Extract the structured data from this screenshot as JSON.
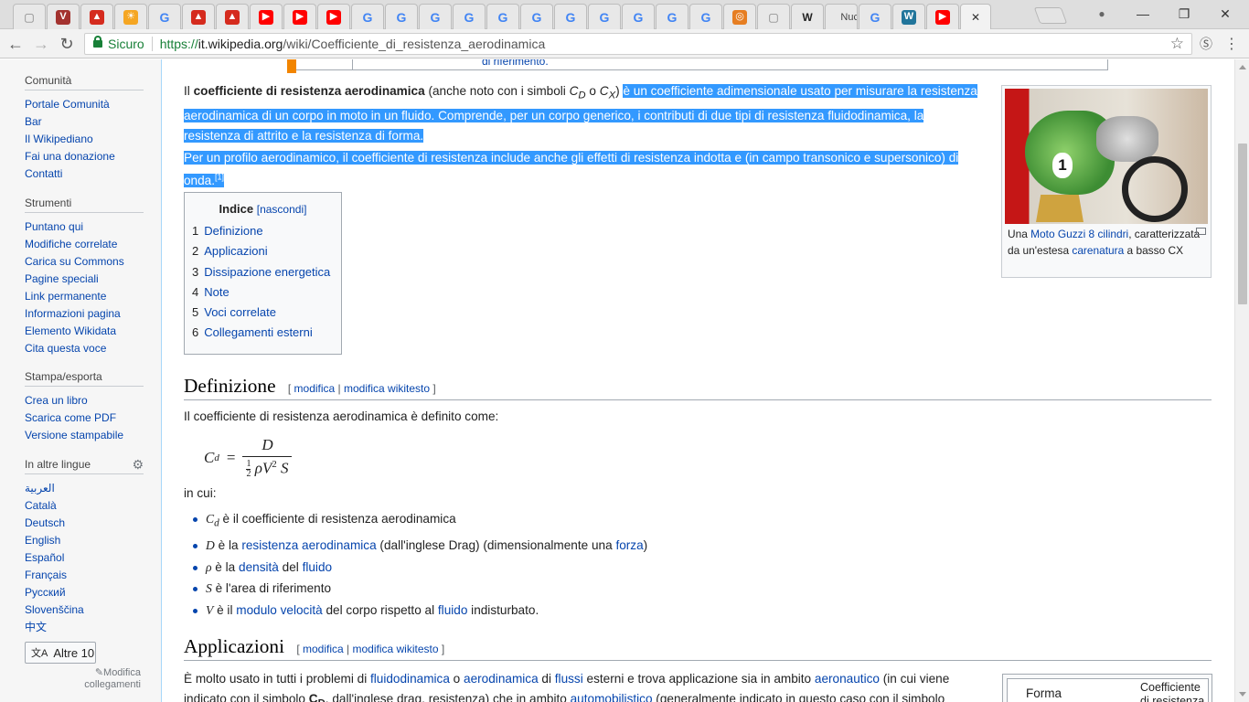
{
  "browser": {
    "tabs": [
      {
        "icon": "page-icon",
        "color": "#777777",
        "glyph": "▢"
      },
      {
        "icon": "wiki-v-icon",
        "color": "#a3322f",
        "glyph": "V"
      },
      {
        "icon": "flag-icon",
        "color": "#d52b1e",
        "glyph": "▲"
      },
      {
        "icon": "sun-icon",
        "color": "#f5a623",
        "glyph": "☀"
      },
      {
        "icon": "google-icon",
        "color": "#4285f4",
        "glyph": "G"
      },
      {
        "icon": "flag-icon",
        "color": "#d52b1e",
        "glyph": "▲"
      },
      {
        "icon": "flag-icon",
        "color": "#d52b1e",
        "glyph": "▲"
      },
      {
        "icon": "youtube-icon",
        "color": "#ff0000",
        "glyph": "▶"
      },
      {
        "icon": "youtube-icon",
        "color": "#ff0000",
        "glyph": "▶"
      },
      {
        "icon": "youtube-icon",
        "color": "#ff0000",
        "glyph": "▶"
      },
      {
        "icon": "google-icon",
        "color": "#4285f4",
        "glyph": "G"
      },
      {
        "icon": "google-icon",
        "color": "#4285f4",
        "glyph": "G"
      },
      {
        "icon": "google-icon",
        "color": "#4285f4",
        "glyph": "G"
      },
      {
        "icon": "google-icon",
        "color": "#4285f4",
        "glyph": "G"
      },
      {
        "icon": "google-icon",
        "color": "#4285f4",
        "glyph": "G"
      },
      {
        "icon": "google-icon",
        "color": "#4285f4",
        "glyph": "G"
      },
      {
        "icon": "google-icon",
        "color": "#4285f4",
        "glyph": "G"
      },
      {
        "icon": "google-icon",
        "color": "#4285f4",
        "glyph": "G"
      },
      {
        "icon": "google-icon",
        "color": "#4285f4",
        "glyph": "G"
      },
      {
        "icon": "google-icon",
        "color": "#4285f4",
        "glyph": "G"
      },
      {
        "icon": "google-icon",
        "color": "#4285f4",
        "glyph": "G"
      },
      {
        "icon": "target-icon",
        "color": "#e67e22",
        "glyph": "◎"
      },
      {
        "icon": "page-icon",
        "color": "#777777",
        "glyph": "▢"
      },
      {
        "icon": "wikipedia-icon",
        "color": "#222222",
        "glyph": "W"
      },
      {
        "icon": "text-icon",
        "color": "#555555",
        "glyph": "",
        "label": "Nuc"
      },
      {
        "icon": "google-icon",
        "color": "#4285f4",
        "glyph": "G"
      },
      {
        "icon": "wordpress-icon",
        "color": "#21759b",
        "glyph": "W"
      },
      {
        "icon": "youtube-icon",
        "color": "#ff0000",
        "glyph": "▶"
      },
      {
        "icon": "close-icon",
        "color": "#333333",
        "glyph": "✕",
        "active": true
      }
    ],
    "window_controls": [
      "person-icon",
      "minimize-icon",
      "restore-icon",
      "close-icon"
    ],
    "address": {
      "secure_label": "Sicuro",
      "scheme": "https://",
      "host": "it.wikipedia.org",
      "path": "/wiki/Coefficiente_di_resistenza_aerodinamica"
    }
  },
  "sidebar": {
    "comunita": {
      "heading": "Comunità",
      "items": [
        "Portale Comunità",
        "Bar",
        "Il Wikipediano",
        "Fai una donazione",
        "Contatti"
      ]
    },
    "strumenti": {
      "heading": "Strumenti",
      "items": [
        "Puntano qui",
        "Modifiche correlate",
        "Carica su Commons",
        "Pagine speciali",
        "Link permanente",
        "Informazioni pagina",
        "Elemento Wikidata",
        "Cita questa voce"
      ]
    },
    "stampa": {
      "heading": "Stampa/esporta",
      "items": [
        "Crea un libro",
        "Scarica come PDF",
        "Versione stampabile"
      ]
    },
    "lingue": {
      "heading": "In altre lingue",
      "items": [
        "العربية",
        "Català",
        "Deutsch",
        "English",
        "Español",
        "Français",
        "Русский",
        "Slovenščina",
        "中文"
      ]
    },
    "other_button": "Altre 10",
    "edit_links": "Modifica collegamenti"
  },
  "content": {
    "topbox_text": "di riferimento.",
    "p1": {
      "lead": "Il ",
      "term": "coefficiente di resistenza aerodinamica",
      "after_term": " (anche noto con i simboli ",
      "sym1": "C",
      "sym1_sub": "D",
      "or": " o ",
      "sym2": "C",
      "sym2_sub": "X",
      "close": ") ",
      "selected": "è un coefficiente adimensionale usato per misurare la resistenza aerodinamica di un corpo in moto in un fluido. Comprende, per un corpo generico, i contributi di due tipi di resistenza fluidodinamica, la resistenza di attrito e la resistenza di forma."
    },
    "p2": {
      "selected": "Per un profilo aerodinamico, il coefficiente di resistenza include anche gli effetti di resistenza indotta e (in campo transonico e supersonico) di onda.",
      "ref": "[1]"
    },
    "thumb": {
      "caption_pre": "Una ",
      "caption_link1": "Moto Guzzi 8 cilindri",
      "caption_mid": ", caratterizzata da un'estesa ",
      "caption_link2": "carenatura",
      "caption_post": " a basso CX",
      "plate_number": "1"
    },
    "toc": {
      "title": "Indice",
      "toggle": "[nascondi]",
      "items": [
        {
          "num": "1",
          "label": "Definizione"
        },
        {
          "num": "2",
          "label": "Applicazioni"
        },
        {
          "num": "3",
          "label": "Dissipazione energetica"
        },
        {
          "num": "4",
          "label": "Note"
        },
        {
          "num": "5",
          "label": "Voci correlate"
        },
        {
          "num": "6",
          "label": "Collegamenti esterni"
        }
      ]
    },
    "definizione": {
      "title": "Definizione",
      "edit_open": "[ ",
      "edit": "modifica",
      "edit_sep": " | ",
      "edit_wiki": "modifica wikitesto",
      "edit_close": " ]",
      "intro": "Il coefficiente di resistenza aerodinamica è definito come:",
      "formula": {
        "lhs": "C",
        "lhs_sub": "d",
        "eq": "=",
        "num": "D",
        "den_half_n": "1",
        "den_half_d": "2",
        "den_rest": "ρV",
        "den_sq": "2",
        "den_s": "S"
      },
      "in_cui": "in cui:",
      "bullets": [
        {
          "sym": "C",
          "sub": "d",
          "pre": " è il coefficiente di resistenza aerodinamica",
          "link": "",
          "post": "",
          "link2": "",
          "post2": ""
        },
        {
          "sym": "D",
          "sub": "",
          "pre": " è la ",
          "link": "resistenza aerodinamica",
          "post": " (dall'inglese Drag) (dimensionalmente una ",
          "link2": "forza",
          "post2": ")"
        },
        {
          "sym": "ρ",
          "sub": "",
          "pre": " è la ",
          "link": "densità",
          "post": " del ",
          "link2": "fluido",
          "post2": ""
        },
        {
          "sym": "S",
          "sub": "",
          "pre": " è l'area di riferimento",
          "link": "",
          "post": "",
          "link2": "",
          "post2": ""
        },
        {
          "sym": "V",
          "sub": "",
          "pre": " è il ",
          "link": "modulo velocità",
          "post": " del corpo rispetto al ",
          "link2": "fluido",
          "post2": " indisturbato."
        }
      ]
    },
    "applicazioni": {
      "title": "Applicazioni",
      "edit_open": "[ ",
      "edit": "modifica",
      "edit_sep": " | ",
      "edit_wiki": "modifica wikitesto",
      "edit_close": " ]",
      "line1_pre": "È molto usato in tutti i problemi di ",
      "line1_link1": "fluidodinamica",
      "line1_mid1": " o ",
      "line1_link2": "aerodinamica",
      "line1_mid2": " di ",
      "line1_link3": "flussi",
      "line1_mid3": " esterni e trova applicazione sia in ambito ",
      "line1_link4": "aeronautico",
      "line1_post": " (in cui viene",
      "line2_pre": "indicato con il simbolo ",
      "line2_sym": "C",
      "line2_sub": "D",
      "line2_mid": ", dall'inglese drag, resistenza) che in ambito ",
      "line2_link": "automobilistico",
      "line2_post": " (generalmente indicato in questo caso con il simbolo",
      "table_h1": "Forma",
      "table_h2": "Coefficiente di resistenza"
    }
  }
}
